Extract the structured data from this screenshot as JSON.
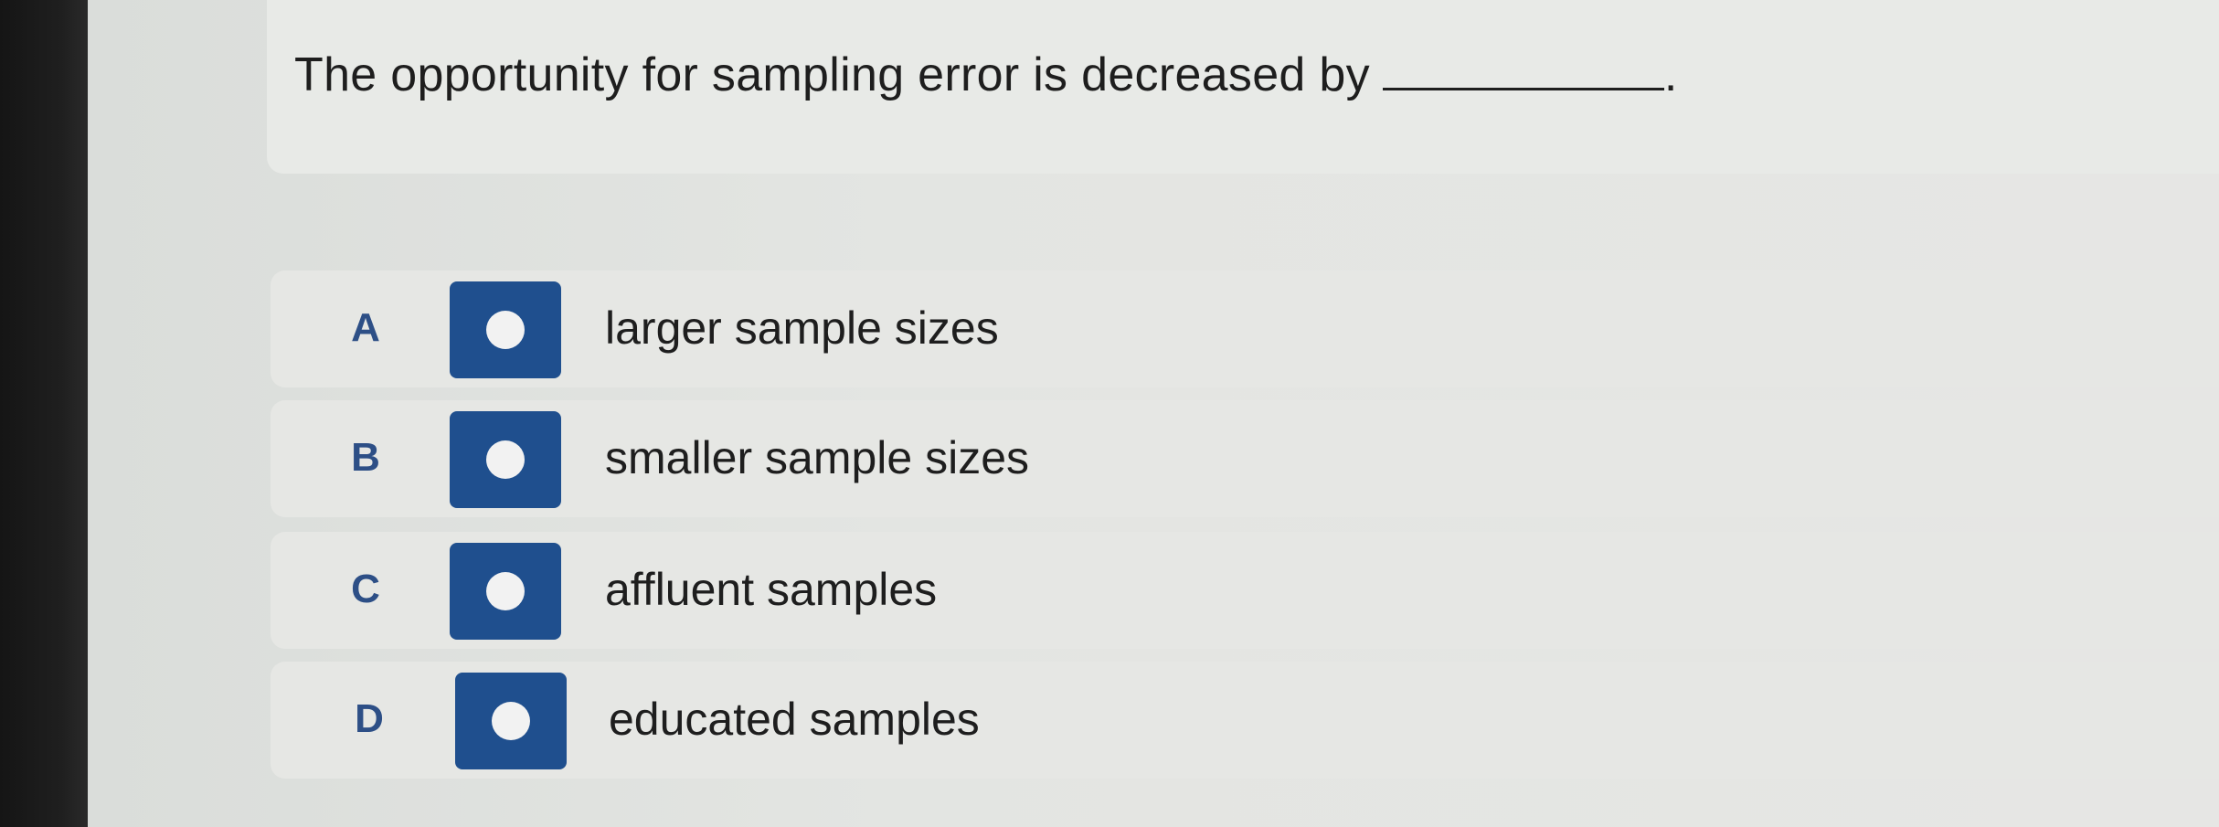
{
  "question": {
    "text": "The opportunity for sampling error is decreased by",
    "trailing": "."
  },
  "options": [
    {
      "letter": "A",
      "text": "larger sample sizes"
    },
    {
      "letter": "B",
      "text": "smaller sample sizes"
    },
    {
      "letter": "C",
      "text": "affluent samples"
    },
    {
      "letter": "D",
      "text": "educated samples"
    }
  ],
  "colors": {
    "radio_fill": "#1f4f8e",
    "letter_color": "#2d4f86",
    "text_color": "#1e1e1e"
  },
  "icons": {
    "radio": "radio-button-icon"
  }
}
